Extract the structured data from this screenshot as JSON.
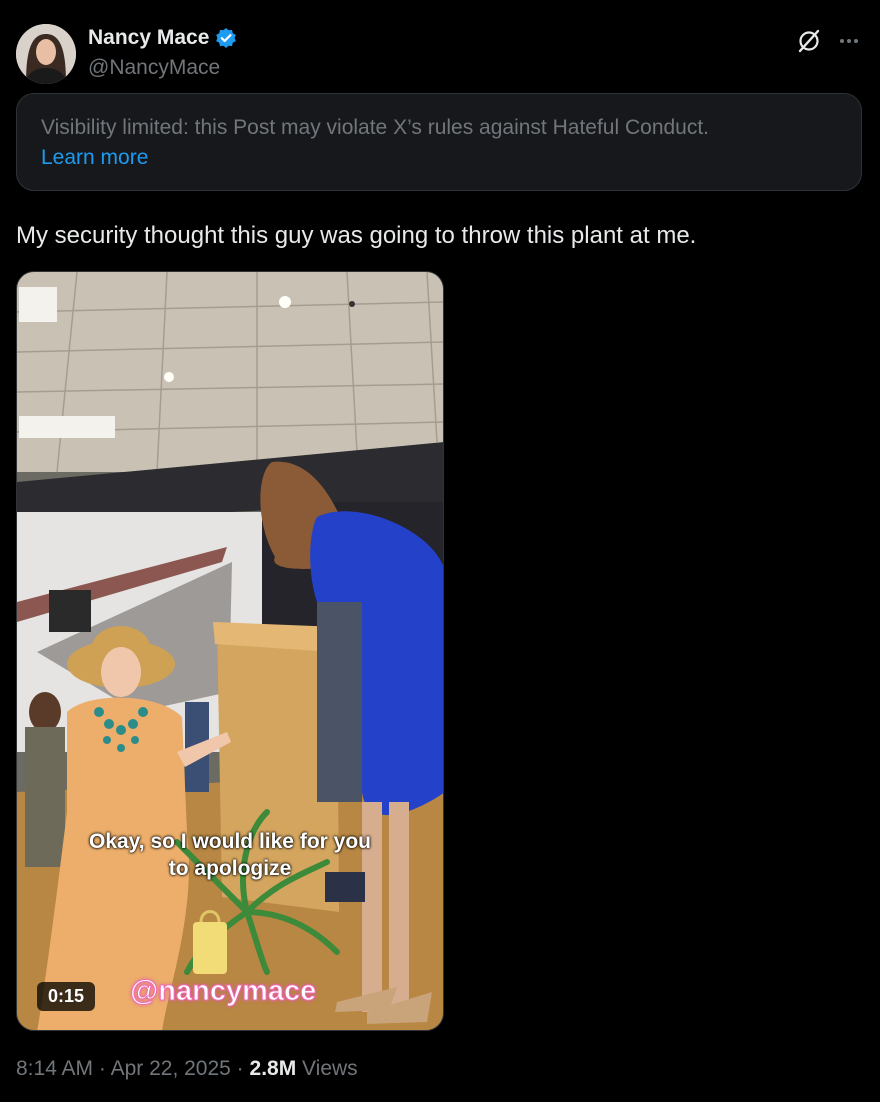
{
  "author": {
    "display_name": "Nancy Mace",
    "handle": "@NancyMace",
    "verified": true,
    "avatar_icon": "avatar"
  },
  "header_icons": [
    "grok-icon",
    "more-icon"
  ],
  "notice": {
    "text": "Visibility limited: this Post may violate X’s rules against Hateful Conduct.",
    "link": "Learn more"
  },
  "post": {
    "text": "My security thought this guy was going to throw this plant at me."
  },
  "video": {
    "caption_line1": "Okay, so I would like for you",
    "caption_line2": "to apologize",
    "watermark": "@nancymace",
    "duration": "0:15"
  },
  "meta": {
    "time": "8:14 AM",
    "sep1": " · ",
    "date": "Apr 22, 2025",
    "sep2": " · ",
    "views_count": "2.8M",
    "views_label": " Views"
  },
  "colors": {
    "background": "#000000",
    "text": "#e7e9ea",
    "muted": "#71767b",
    "link": "#1d9bf0",
    "verified": "#1d9bf0"
  }
}
